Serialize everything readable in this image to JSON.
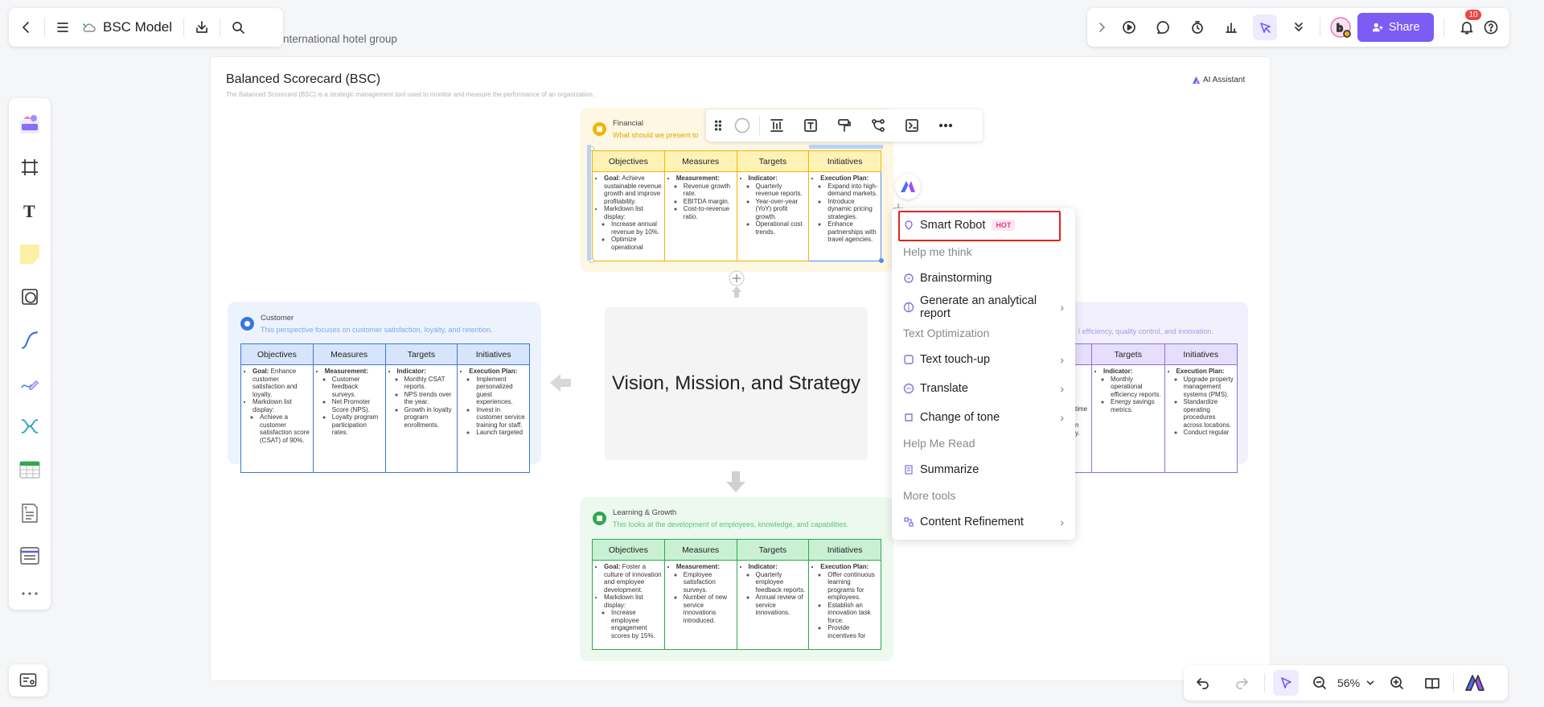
{
  "app": {
    "doc_title": "BSC Model",
    "breadcrumb": "nternational hotel group",
    "share_label": "Share",
    "notification_count": "10",
    "zoom": "56%",
    "accent_color": "#7b5cf5"
  },
  "board": {
    "title": "Balanced Scorecard (BSC)",
    "description": "The Balanced Scorecard (BSC) is a strategic management tool used to monitor and measure the performance of an organization.",
    "ai_assistant": "AI Assistant",
    "center_text": "Vision, Mission, and Strategy",
    "columns": [
      "Objectives",
      "Measures",
      "Targets",
      "Initiatives"
    ]
  },
  "cards": {
    "financial": {
      "title": "Financial",
      "subtitle": "What should we present to",
      "color": "#f4b400",
      "cells": [
        "<ul><li><b>Goal:</b> Achieve sustainable revenue growth and improve profitability.</li><li>Markdown list display:<ul><li>Increase annual revenue by 10%.</li><li>Optimize operational</li></ul></li></ul>",
        "<ul><li><b>Measurement:</b><ul><li>Revenue growth rate.</li><li>EBITDA margin.</li><li>Cost-to-revenue ratio.</li></ul></li></ul>",
        "<ul><li><b>Indicator:</b><ul><li>Quarterly revenue reports.</li><li>Year-over-year (YoY) profit growth.</li><li>Operational cost trends.</li></ul></li></ul>",
        "<ul><li><b>Execution Plan:</b><ul><li>Expand into high-demand markets.</li><li>Introduce dynamic pricing strategies.</li><li>Enhance partnerships with travel agencies.</li></ul></li></ul>"
      ]
    },
    "customer": {
      "title": "Customer",
      "subtitle": "This perspective focuses on customer satisfaction, loyalty, and retention.",
      "color": "#3a78d8",
      "cells": [
        "<ul><li><b>Goal:</b> Enhance customer satisfaction and loyalty.</li><li>Markdown list display:<ul><li>Achieve a customer satisfaction score (CSAT) of 90%.</li></ul></li></ul>",
        "<ul><li><b>Measurement:</b><ul><li>Customer feedback surveys.</li><li>Net Promoter Score (NPS).</li><li>Loyalty program participation rates.</li></ul></li></ul>",
        "<ul><li><b>Indicator:</b><ul><li>Monthly CSAT reports.</li><li>NPS trends over the year.</li><li>Growth in loyalty program enrollments.</li></ul></li></ul>",
        "<ul><li><b>Execution Plan:</b><ul><li>Implement personalized guest experiences.</li><li>Invest in customer service training for staff.</li><li>Launch targeted</li></ul></li></ul>"
      ]
    },
    "internal": {
      "subtitle_partial": "l efficiency, quality control, and innovation.",
      "color": "#8b6fe0",
      "partial_measures": [
        "time",
        "n",
        "y."
      ],
      "cells": [
        "<ul><li><b>Indicator:</b><ul><li>Monthly operational efficiency reports.</li><li>Energy savings metrics.</li></ul></li></ul>",
        "<ul><li><b>Execution Plan:</b><ul><li>Upgrade property management systems (PMS).</li><li>Standardize operating procedures across locations.</li><li>Conduct regular</li></ul></li></ul>"
      ]
    },
    "learning": {
      "title": "Learning & Growth",
      "subtitle": "This looks at the development of employees, knowledge, and capabilities.",
      "color": "#2fa84f",
      "cells": [
        "<ul><li><b>Goal:</b> Foster a culture of innovation and employee development.</li><li>Markdown list display:<ul><li>Increase employee engagement scores by 15%.</li></ul></li></ul>",
        "<ul><li><b>Measurement:</b><ul><li>Employee satisfaction surveys.</li><li>Number of new service innovations introduced.</li></ul></li></ul>",
        "<ul><li><b>Indicator:</b><ul><li>Quarterly employee feedback reports.</li><li>Annual review of service innovations.</li></ul></li></ul>",
        "<ul><li><b>Execution Plan:</b><ul><li>Offer continuous learning programs for employees.</li><li>Establish an innovation task force.</li><li>Provide incentives for</li></ul></li></ul>"
      ]
    }
  },
  "ai_menu": {
    "smart_robot": "Smart Robot",
    "hot": "HOT",
    "section_think": "Help me think",
    "brainstorming": "Brainstorming",
    "analytical_report": "Generate an analytical report",
    "section_text": "Text Optimization",
    "touch_up": "Text touch-up",
    "translate": "Translate",
    "tone": "Change of tone",
    "section_read": "Help Me Read",
    "summarize": "Summarize",
    "section_more": "More tools",
    "refinement": "Content Refinement"
  }
}
